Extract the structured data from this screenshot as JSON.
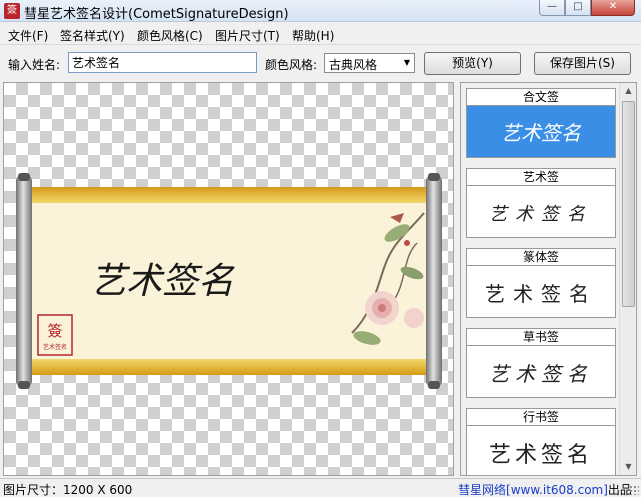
{
  "window": {
    "title": "彗星艺术签名设计(CometSignatureDesign)",
    "icon": "app-logo-icon",
    "controls": {
      "minimize": "minimize-icon",
      "maximize": "maximize-icon",
      "close": "close-icon"
    }
  },
  "menu": {
    "items": [
      {
        "label": "文件(F)"
      },
      {
        "label": "签名样式(Y)"
      },
      {
        "label": "颜色风格(C)"
      },
      {
        "label": "图片尺寸(T)"
      },
      {
        "label": "帮助(H)"
      }
    ]
  },
  "toolbar": {
    "name_label": "输入姓名:",
    "name_value": "艺术签名",
    "color_label": "颜色风格:",
    "color_selected": "古典风格",
    "preview_label": "预览(Y)",
    "save_label": "保存图片(S)"
  },
  "canvas": {
    "signature_text": "艺术签名",
    "stamp_text": "艺术签名"
  },
  "styles": [
    {
      "title": "合文签",
      "sample": "艺术签名",
      "selected": true
    },
    {
      "title": "艺术签",
      "sample": "艺术签名",
      "selected": false
    },
    {
      "title": "篆体签",
      "sample": "艺术签名",
      "selected": false
    },
    {
      "title": "草书签",
      "sample": "艺术签名",
      "selected": false
    },
    {
      "title": "行书签",
      "sample": "艺术签名",
      "selected": false
    }
  ],
  "status": {
    "size_text": "图片尺寸：1200 X 600",
    "publisher_name": "彗星网络",
    "publisher_url": "[www.it608.com]",
    "publisher_suffix": "出品"
  },
  "colors": {
    "accent": "#3a8ee6",
    "scroll_gold": "#e9b830",
    "paper": "#fbf3d9"
  }
}
